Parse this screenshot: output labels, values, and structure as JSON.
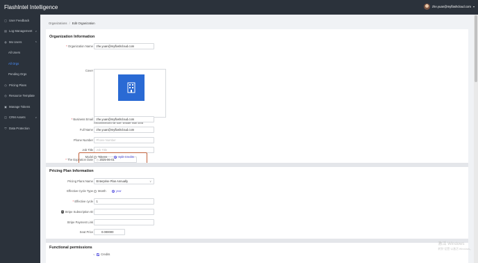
{
  "app": {
    "title": "FlashIntel Intelligence"
  },
  "user": {
    "email": "zhe.yuan@myflashcloud.com"
  },
  "sidebar": {
    "items": [
      {
        "label": "User Feedback",
        "icon": "feedback-icon"
      },
      {
        "label": "Log Management",
        "icon": "log-icon",
        "expandable": true
      },
      {
        "label": "Mo Users",
        "icon": "users-icon",
        "expandable": true,
        "expanded": true
      },
      {
        "label": "All Users",
        "sub": true
      },
      {
        "label": "All Orgs",
        "sub": true,
        "active": true
      },
      {
        "label": "Pending Orgs",
        "sub": true
      },
      {
        "label": "Pricing Plans",
        "icon": "pricing-icon"
      },
      {
        "label": "Resource Template",
        "icon": "template-icon"
      },
      {
        "label": "Manage Tokens",
        "icon": "token-icon"
      },
      {
        "label": "CRM Assets",
        "icon": "crm-icon",
        "expandable": true
      },
      {
        "label": "Data Protection",
        "icon": "shield-icon"
      }
    ]
  },
  "breadcrumb": {
    "parent": "Organizations",
    "separator": "/",
    "current": "Edit Organization"
  },
  "org_info": {
    "title": "Organization Information",
    "org_name_label": "Organization Name",
    "org_name": "zhe.yuan@myflashcloud.com",
    "cover_label": "Cover",
    "cover_hint": "Recommended file size: smaller than 5MB",
    "business_email_label": "Business Email",
    "business_email": "zhe.yuan@myflashcloud.com",
    "full_name_label": "Full Name",
    "full_name": "zhe.yuan@myflashcloud.com",
    "phone_label": "Phone Number",
    "phone_placeholder": "Phone Number",
    "job_title_label": "Job Title",
    "job_title_placeholder": "Job Title",
    "expiration_label": "The Expiration Date",
    "expiration_value": "2025-06-01",
    "model_label": "Model",
    "model_options": [
      "Tokens",
      "Split Credits"
    ],
    "model_selected": "Split Credits"
  },
  "pricing": {
    "title": "Pricing Plan Information",
    "plan_name_label": "Pricing Plans Name",
    "plan_name": "Enterprise Plan Annually",
    "cycle_type_label": "Effective Cycle Type",
    "cycle_options": [
      "Month",
      "year"
    ],
    "cycle_selected": "year",
    "cycle_label": "Effective cycle",
    "cycle_value": "1",
    "stripe_sub_label": "Stripe Subscription ID",
    "stripe_link_label": "Stripe Payment Link",
    "seat_price_label": "Seat Price",
    "seat_price": "0.000000"
  },
  "permissions": {
    "title": "Functional permissions",
    "credits_label": "Credits"
  },
  "watermark": {
    "line1": "激活 Windows",
    "line2": "转到\"设置\"以激活 Windows。"
  },
  "colors": {
    "sidebar_bg": "#2b323b",
    "accent": "#5b57e0",
    "active_nav": "#4a8fff",
    "highlight_box": "#c0603a",
    "cover_bg": "#2a6ad4"
  }
}
